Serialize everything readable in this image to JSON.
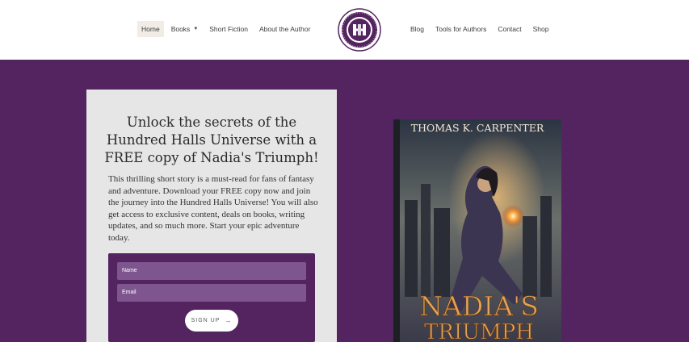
{
  "nav": {
    "left": [
      {
        "label": "Home",
        "active": true
      },
      {
        "label": "Books",
        "dropdown": true
      },
      {
        "label": "Short Fiction"
      },
      {
        "label": "About the Author"
      }
    ],
    "right": [
      {
        "label": "Blog"
      },
      {
        "label": "Tools for Authors"
      },
      {
        "label": "Contact"
      },
      {
        "label": "Shop"
      }
    ]
  },
  "logo": {
    "top_text": "HUNDRED",
    "bottom_text": "HALLS",
    "monogram": "HH"
  },
  "promo": {
    "title": "Unlock the secrets of the Hundred Halls Universe with a FREE copy of Nadia's Triumph!",
    "body": "This thrilling short story is a must-read for fans of fantasy and adventure. Download your FREE copy now and join the journey into the Hundred Halls Universe!  You will also get access to exclusive content, deals on books, writing updates, and so much more. Start your epic adventure today."
  },
  "form": {
    "name_placeholder": "Name",
    "email_placeholder": "Email",
    "submit_label": "SIGN UP",
    "submit_icon": "arrow-right-icon"
  },
  "book": {
    "author": "Thomas K. Carpenter",
    "title_line1": "Nadia's",
    "title_line2": "Triumph"
  },
  "colors": {
    "brand_purple": "#542460",
    "field_purple": "#7f5590",
    "gold": "#e0a55a"
  }
}
